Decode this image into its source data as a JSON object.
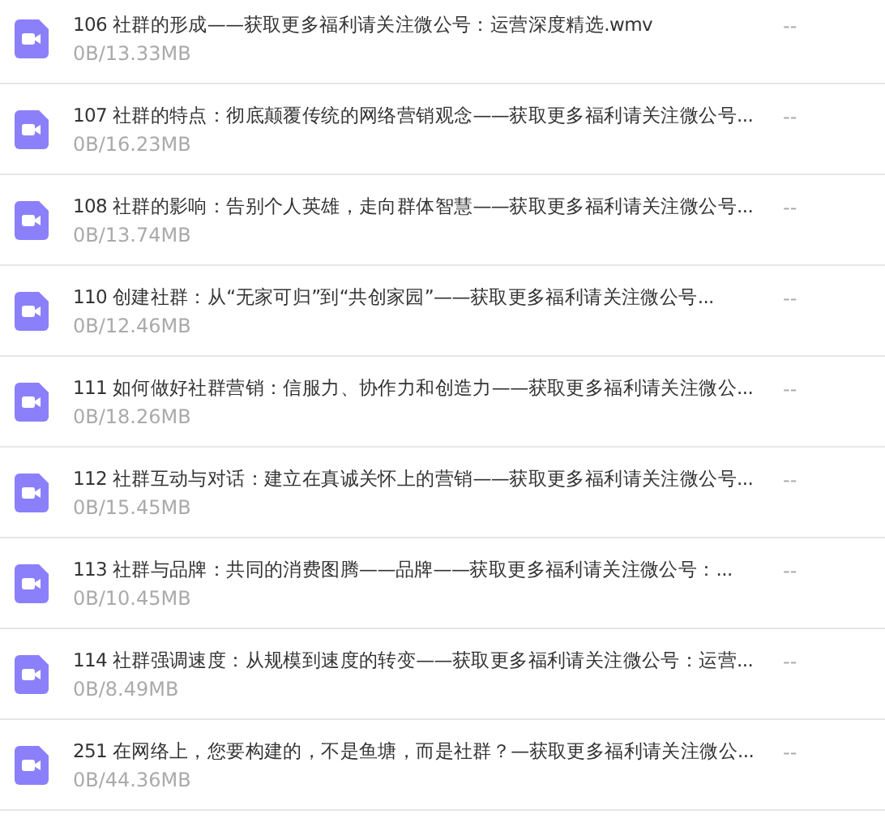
{
  "files": [
    {
      "name": "106 社群的形成——获取更多福利请关注微公号：运营深度精选.wmv",
      "progress": "0B/13.33MB",
      "status": "--"
    },
    {
      "name": "107 社群的特点：彻底颠覆传统的网络营销观念——获取更多福利请关注微公号...",
      "progress": "0B/16.23MB",
      "status": "--"
    },
    {
      "name": "108 社群的影响：告别个人英雄，走向群体智慧——获取更多福利请关注微公号...",
      "progress": "0B/13.74MB",
      "status": "--"
    },
    {
      "name": "110 创建社群：从“无家可归”到“共创家园”——获取更多福利请关注微公号...",
      "progress": "0B/12.46MB",
      "status": "--"
    },
    {
      "name": "111 如何做好社群营销：信服力、协作力和创造力——获取更多福利请关注微公...",
      "progress": "0B/18.26MB",
      "status": "--"
    },
    {
      "name": "112 社群互动与对话：建立在真诚关怀上的营销——获取更多福利请关注微公号...",
      "progress": "0B/15.45MB",
      "status": "--"
    },
    {
      "name": "113 社群与品牌：共同的消费图腾——品牌——获取更多福利请关注微公号：...",
      "progress": "0B/10.45MB",
      "status": "--"
    },
    {
      "name": "114 社群强调速度：从规模到速度的转变——获取更多福利请关注微公号：运营...",
      "progress": "0B/8.49MB",
      "status": "--"
    },
    {
      "name": "251 在网络上，您要构建的，不是鱼塘，而是社群？—获取更多福利请关注微公...",
      "progress": "0B/44.36MB",
      "status": "--"
    }
  ]
}
